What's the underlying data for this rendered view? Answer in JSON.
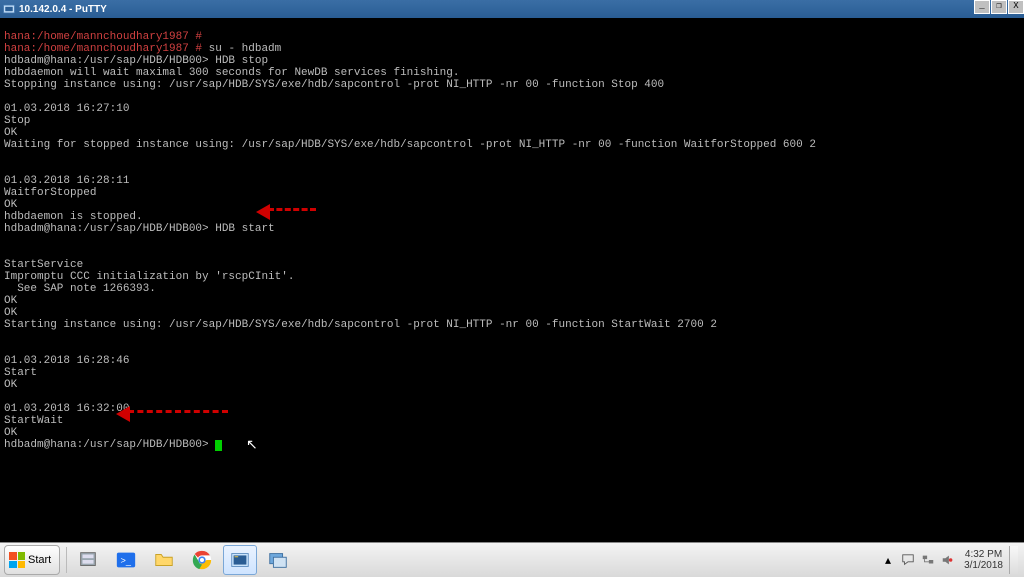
{
  "window": {
    "title": "10.142.0.4 - PuTTY"
  },
  "terminal": {
    "l01a": "hana:/home/mannchoudhary1987 #",
    "l02a": "hana:/home/mannchoudhary1987 #",
    "l02b": " su - hdbadm",
    "l03": "hdbadm@hana:/usr/sap/HDB/HDB00> HDB stop",
    "l04": "hdbdaemon will wait maximal 300 seconds for NewDB services finishing.",
    "l05": "Stopping instance using: /usr/sap/HDB/SYS/exe/hdb/sapcontrol -prot NI_HTTP -nr 00 -function Stop 400",
    "l06": "",
    "l07": "01.03.2018 16:27:10",
    "l08": "Stop",
    "l09": "OK",
    "l10": "Waiting for stopped instance using: /usr/sap/HDB/SYS/exe/hdb/sapcontrol -prot NI_HTTP -nr 00 -function WaitforStopped 600 2",
    "l11": "",
    "l12": "",
    "l13": "01.03.2018 16:28:11",
    "l14": "WaitforStopped",
    "l15": "OK",
    "l16": "hdbdaemon is stopped.",
    "l17": "hdbadm@hana:/usr/sap/HDB/HDB00> HDB start",
    "l18": "",
    "l19": "",
    "l20": "StartService",
    "l21": "Impromptu CCC initialization by 'rscpCInit'.",
    "l22": "  See SAP note 1266393.",
    "l23": "OK",
    "l24": "OK",
    "l25": "Starting instance using: /usr/sap/HDB/SYS/exe/hdb/sapcontrol -prot NI_HTTP -nr 00 -function StartWait 2700 2",
    "l26": "",
    "l27": "",
    "l28": "01.03.2018 16:28:46",
    "l29": "Start",
    "l30": "OK",
    "l31": "",
    "l32": "01.03.2018 16:32:00",
    "l33": "StartWait",
    "l34": "OK",
    "l35": "hdbadm@hana:/usr/sap/HDB/HDB00> "
  },
  "taskbar": {
    "start": "Start",
    "time": "4:32 PM",
    "date": "3/1/2018"
  }
}
